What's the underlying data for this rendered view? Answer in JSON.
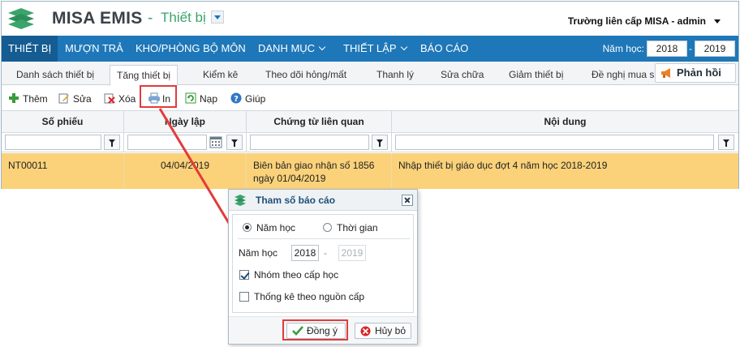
{
  "header": {
    "brand": "MISA EMIS",
    "separator": "-",
    "module": "Thiết bị",
    "school_user": "Trường liên cấp MISA - admin"
  },
  "menu": {
    "items": [
      {
        "label": "THIẾT BỊ",
        "active": true
      },
      {
        "label": "MƯỢN TRẢ"
      },
      {
        "label": "KHO/PHÒNG BỘ MÔN"
      },
      {
        "label": "DANH MỤC",
        "dropdown": true
      },
      {
        "label": "THIẾT LẬP",
        "dropdown": true
      },
      {
        "label": "BÁO CÁO"
      }
    ],
    "year_label": "Năm học:",
    "year_from": "2018",
    "year_dash": "-",
    "year_to": "2019"
  },
  "tabs": {
    "items": [
      "Danh sách thiết bị",
      "Tăng thiết bị",
      "Kiểm kê",
      "Theo dõi hỏng/mất",
      "Thanh lý",
      "Sửa chữa",
      "Giảm thiết bị",
      "Đề nghị mua sắ"
    ],
    "active_index": 1,
    "feedback": "Phản hồi"
  },
  "toolbar": {
    "add": "Thêm",
    "edit": "Sửa",
    "delete": "Xóa",
    "print": "In",
    "load": "Nạp",
    "help": "Giúp"
  },
  "grid": {
    "columns": [
      "Số phiếu",
      "Ngày lập",
      "Chứng từ liên quan",
      "Nội dung"
    ],
    "rows": [
      {
        "so_phieu": "NT00011",
        "ngay_lap": "04/04/2019",
        "chung_tu": "Biên bản giao nhận số 1856 ngày 01/04/2019",
        "noi_dung": "Nhập thiết bị giáo dục đợt 4 năm học 2018-2019"
      }
    ]
  },
  "dialog": {
    "title": "Tham số báo cáo",
    "radio_school_year": "Năm học",
    "radio_time": "Thời gian",
    "year_label": "Năm học",
    "year_from": "2018",
    "year_dash": "-",
    "year_to": "2019",
    "group_by_level": "Nhóm theo cấp học",
    "stat_by_source": "Thống kê theo nguồn cấp",
    "ok": "Đồng ý",
    "cancel": "Hủy bỏ"
  },
  "colors": {
    "menubar": "#1e77b8",
    "selected_row": "#fbd27a",
    "highlight": "#e23b3b",
    "brand_green": "#3aa56a"
  }
}
